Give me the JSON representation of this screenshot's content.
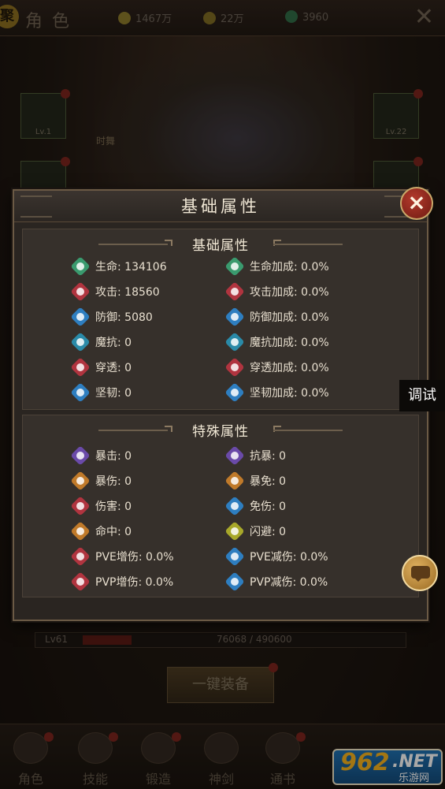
{
  "topbar": {
    "badge": "聚",
    "title": "角色",
    "resources": [
      {
        "icon": "coin-icon",
        "value": "1467万",
        "color": "#8b7a2a"
      },
      {
        "icon": "ingot-icon",
        "value": "22万",
        "color": "#7d6b22"
      },
      {
        "icon": "jade-icon",
        "value": "3960",
        "color": "#2d6a46"
      }
    ]
  },
  "background": {
    "hero_name": "时舞",
    "slot_left_level": "Lv.1",
    "slot_right_level": "Lv.22",
    "exp_level": "Lv61",
    "exp_value": "76068 / 490600",
    "exp_progress": 0.155,
    "equip_button": "一键装备"
  },
  "dialog": {
    "title": "基础属性",
    "close_label": "×",
    "basic_section": {
      "title": "基础属性",
      "left": [
        {
          "label": "生命: 134106",
          "icon": "hp-icon",
          "color": "#3a9a6e"
        },
        {
          "label": "攻击: 18560",
          "icon": "attack-icon",
          "color": "#b0343f"
        },
        {
          "label": "防御: 5080",
          "icon": "defense-icon",
          "color": "#2e7ec0"
        },
        {
          "label": "魔抗: 0",
          "icon": "magic-resist-icon",
          "color": "#2a8aa8"
        },
        {
          "label": "穿透: 0",
          "icon": "penetration-icon",
          "color": "#b0343f"
        },
        {
          "label": "坚韧: 0",
          "icon": "tenacity-icon",
          "color": "#2e7ec0"
        }
      ],
      "right": [
        {
          "label": "生命加成: 0.0%",
          "icon": "hp-bonus-icon",
          "color": "#3a9a6e"
        },
        {
          "label": "攻击加成: 0.0%",
          "icon": "attack-bonus-icon",
          "color": "#b0343f"
        },
        {
          "label": "防御加成: 0.0%",
          "icon": "defense-bonus-icon",
          "color": "#2e7ec0"
        },
        {
          "label": "魔抗加成: 0.0%",
          "icon": "magic-resist-bonus-icon",
          "color": "#2a8aa8"
        },
        {
          "label": "穿透加成: 0.0%",
          "icon": "penetration-bonus-icon",
          "color": "#b0343f"
        },
        {
          "label": "坚韧加成: 0.0%",
          "icon": "tenacity-bonus-icon",
          "color": "#2e7ec0"
        }
      ]
    },
    "special_section": {
      "title": "特殊属性",
      "left": [
        {
          "label": "暴击: 0",
          "icon": "crit-icon",
          "color": "#6a4aa8"
        },
        {
          "label": "暴伤: 0",
          "icon": "crit-damage-icon",
          "color": "#c07a2a"
        },
        {
          "label": "伤害: 0",
          "icon": "damage-icon",
          "color": "#b0343f"
        },
        {
          "label": "命中: 0",
          "icon": "hit-icon",
          "color": "#c07a2a"
        },
        {
          "label": "PVE增伤: 0.0%",
          "icon": "pve-damage-icon",
          "color": "#b0343f"
        },
        {
          "label": "PVP增伤: 0.0%",
          "icon": "pvp-damage-icon",
          "color": "#b0343f"
        }
      ],
      "right": [
        {
          "label": "抗暴: 0",
          "icon": "crit-resist-icon",
          "color": "#6a4aa8"
        },
        {
          "label": "暴免: 0",
          "icon": "crit-immune-icon",
          "color": "#c07a2a"
        },
        {
          "label": "免伤: 0",
          "icon": "damage-reduction-icon",
          "color": "#2e7ec0"
        },
        {
          "label": "闪避: 0",
          "icon": "dodge-icon",
          "color": "#a8a82a"
        },
        {
          "label": "PVE减伤: 0.0%",
          "icon": "pve-reduction-icon",
          "color": "#2e7ec0"
        },
        {
          "label": "PVP减伤: 0.0%",
          "icon": "pvp-reduction-icon",
          "color": "#2e7ec0"
        }
      ]
    }
  },
  "floating": {
    "debug_label": "调试",
    "chat_icon": "chat-icon"
  },
  "bottom_nav": {
    "items": [
      {
        "label": "角色",
        "icon": "hero-icon"
      },
      {
        "label": "技能",
        "icon": "skill-icon"
      },
      {
        "label": "锻造",
        "icon": "forge-icon"
      },
      {
        "label": "神剑",
        "icon": "sword-icon"
      },
      {
        "label": "通书",
        "icon": "book-icon"
      }
    ]
  },
  "watermark": {
    "number": "962",
    "dot_net": ".NET",
    "sub": "乐游网"
  }
}
